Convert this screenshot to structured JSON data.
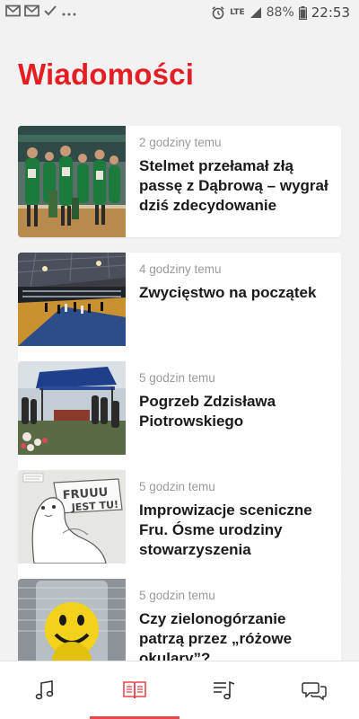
{
  "status_bar": {
    "left_icons": [
      "mail-icon",
      "mail-icon",
      "check-icon",
      "more-dots-icon"
    ],
    "network": "LTE",
    "battery": "88%",
    "time": "22:53"
  },
  "page": {
    "title": "Wiadomości"
  },
  "colors": {
    "accent": "#e31e24",
    "nav_active": "#e8464c",
    "meta": "#9a9a9a"
  },
  "articles": [
    {
      "time": "2 godziny temu",
      "title": "Stelmet przełamał złą passę z Dąbrową – wygrał dziś zdecydowanie",
      "thumb": "basketball-team-photo"
    },
    {
      "time": "4 godziny temu",
      "title": "Zwycięstwo na początek",
      "thumb": "basketball-hall-photo"
    },
    {
      "time": "5 godzin temu",
      "title": "Pogrzeb Zdzisława Piotrowskiego",
      "thumb": "funeral-tent-photo"
    },
    {
      "time": "5 godzin temu",
      "title": "Improwizacje sceniczne Fru. Ósme urodziny stowarzyszenia",
      "thumb": "fruuu-poster-photo"
    },
    {
      "time": "5 godzin temu",
      "title": "Czy zielonogórzanie patrzą przez „różowe okulary”?",
      "thumb": "smiley-ball-photo"
    }
  ],
  "thumb_text": {
    "fru_line1": "FRUUU",
    "fru_line2": "JEST TU!"
  },
  "bottom_nav": {
    "items": [
      "music-icon",
      "news-book-icon",
      "playlist-icon",
      "chat-icon"
    ],
    "active": 1
  }
}
